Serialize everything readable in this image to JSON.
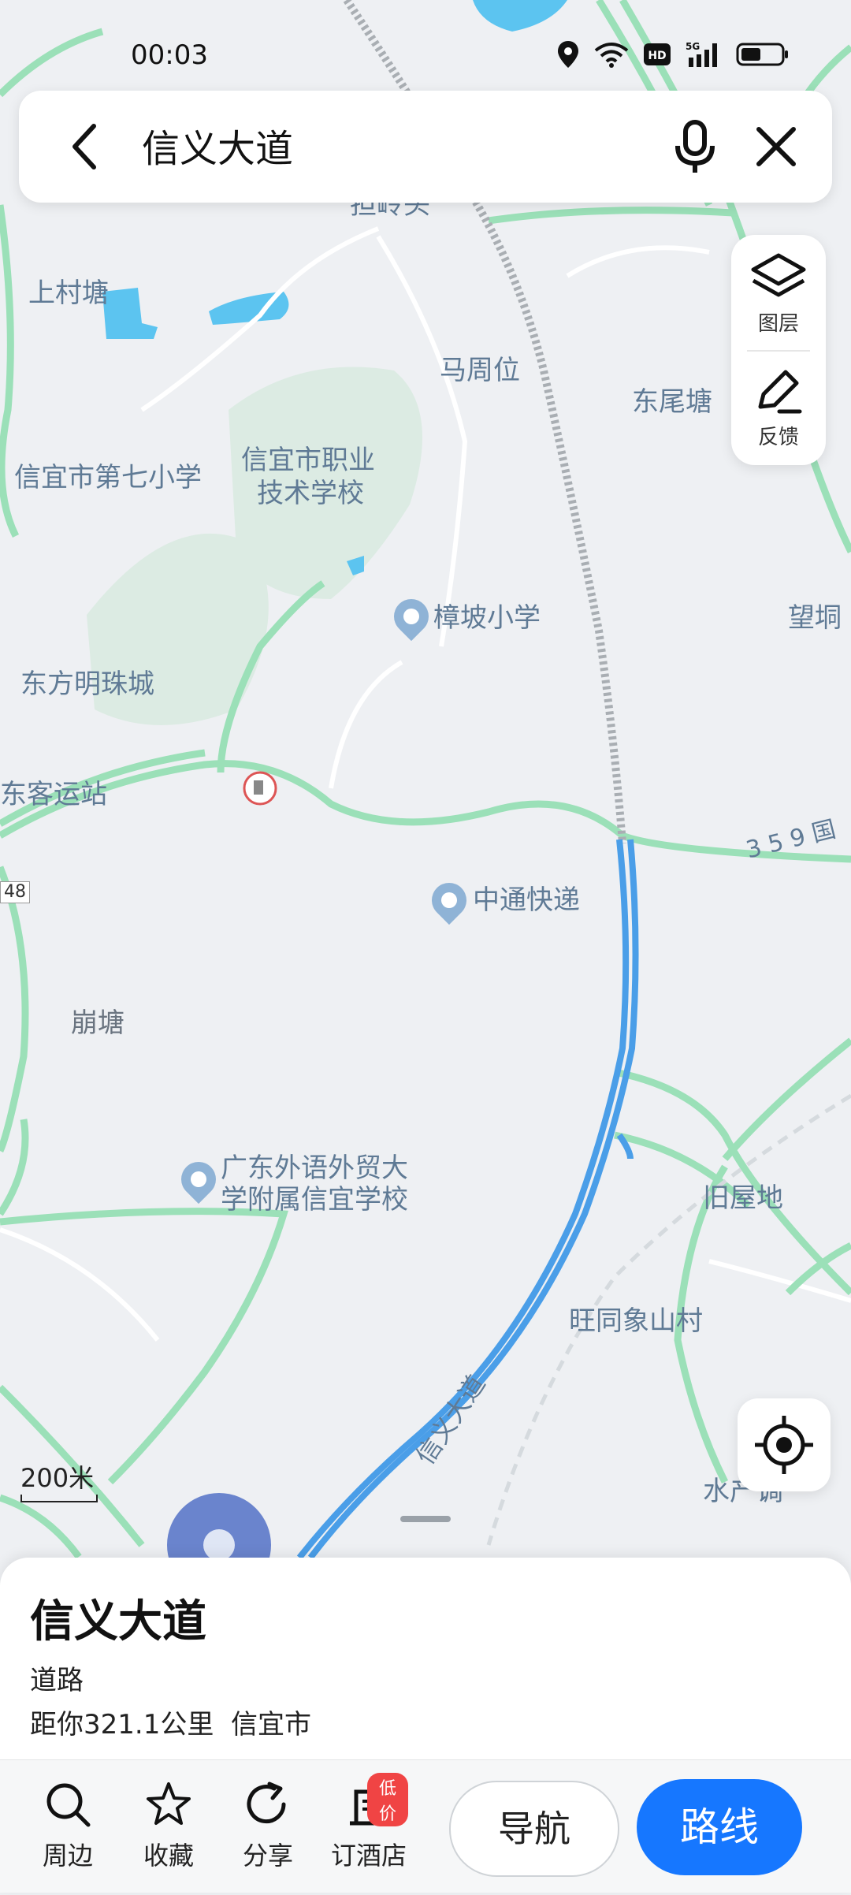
{
  "status_bar": {
    "time": "00:03"
  },
  "search": {
    "query": "信义大道"
  },
  "side_tools": {
    "layers_label": "图层",
    "feedback_label": "反馈"
  },
  "map": {
    "labels": {
      "dalingtou": "担岭头",
      "shangcuntang": "上村塘",
      "mazhouwei": "马周位",
      "dongweitang": "东尾塘",
      "xinyi_7th_school": "信宜市第七小学",
      "vocational_school_l1": "信宜市职业",
      "vocational_school_l2": "技术学校",
      "zhangpo_school": "樟坡小学",
      "wangtong": "望垌",
      "dongfang_mingzhu": "东方明珠城",
      "dongke_station": "东客运站",
      "road_359": "3 5 9 国",
      "zhongtong": "中通快递",
      "road_48": "48",
      "bengtang": "崩塘",
      "gdufs_school_l1": "广东外语外贸大",
      "gdufs_school_l2": "学附属信宜学校",
      "jiuwudi": "旧屋地",
      "wangtong_xiangshan": "旺同象山村",
      "shuichan": "水产调",
      "xinyi_avenue": "信义大道"
    },
    "scale": "200米"
  },
  "place": {
    "title": "信义大道",
    "type": "道路",
    "distance": "距你321.1公里",
    "city": "信宜市"
  },
  "actions": {
    "nearby": "周边",
    "favorite": "收藏",
    "share": "分享",
    "hotel": "订酒店",
    "hotel_badge": "低价",
    "navigate": "导航",
    "route": "路线"
  },
  "colors": {
    "accent": "#1677ff",
    "road": "#4a9ee8",
    "minor_road": "#9be0b8"
  }
}
